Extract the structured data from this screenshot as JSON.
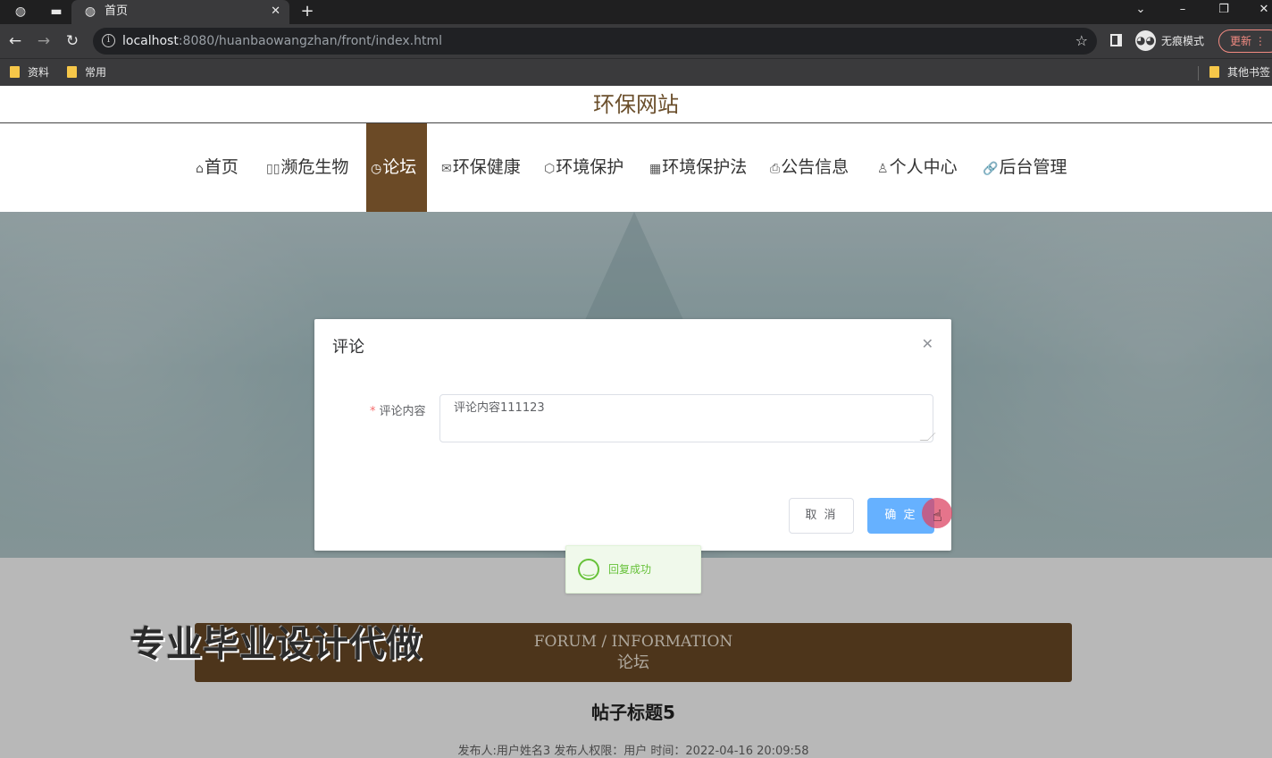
{
  "browser": {
    "tab_title": "首页",
    "url_host": "localhost",
    "url_rest": ":8080/huanbaowangzhan/front/index.html",
    "incognito_label": "无痕模式",
    "update_label": "更新",
    "bookmarks": [
      "资料",
      "常用"
    ],
    "other_bookmarks": "其他书签"
  },
  "site": {
    "title": "环保网站",
    "nav": [
      {
        "icon": "⌂",
        "label": "首页"
      },
      {
        "icon": "▯▯",
        "label": "濒危生物"
      },
      {
        "icon": "◷",
        "label": "论坛"
      },
      {
        "icon": "✉",
        "label": "环保健康"
      },
      {
        "icon": "⬡",
        "label": "环境保护"
      },
      {
        "icon": "▦",
        "label": "环境保护法"
      },
      {
        "icon": "⎙",
        "label": "公告信息"
      },
      {
        "icon": "♙",
        "label": "个人中心"
      },
      {
        "icon": "🔗",
        "label": "后台管理"
      }
    ],
    "active_nav": "论坛"
  },
  "section": {
    "en": "FORUM / INFORMATION",
    "zh": "论坛"
  },
  "post": {
    "title": "帖子标题5",
    "meta": "发布人:用户姓名3   发布人权限：用户   时间：2022-04-16 20:09:58"
  },
  "watermark": "专业毕业设计代做",
  "dialog": {
    "title": "评论",
    "field_label": "评论内容",
    "field_value": "评论内容111123",
    "cancel_label": "取 消",
    "confirm_label": "确 定"
  },
  "toast": {
    "message": "回复成功"
  }
}
